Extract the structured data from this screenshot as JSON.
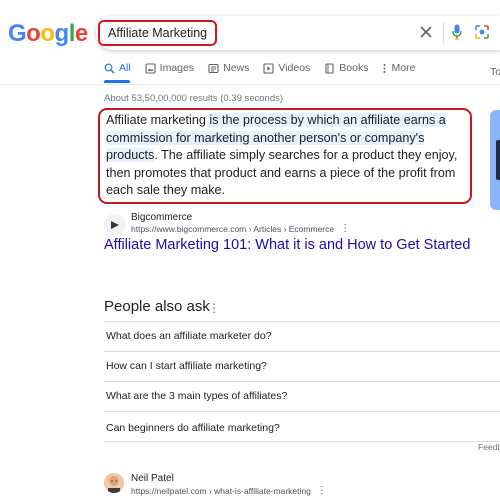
{
  "logo": {
    "letters": [
      "G",
      "o",
      "o",
      "g",
      "l",
      "e"
    ]
  },
  "search": {
    "query": "Affiliate Marketing"
  },
  "tabs": [
    {
      "label": "All",
      "icon": "search-icon",
      "active": true
    },
    {
      "label": "Images",
      "icon": "image-icon"
    },
    {
      "label": "News",
      "icon": "news-icon"
    },
    {
      "label": "Videos",
      "icon": "play-icon"
    },
    {
      "label": "Books",
      "icon": "book-icon"
    },
    {
      "label": "More",
      "icon": "more-dots-icon"
    }
  ],
  "tools_label": "To",
  "result_stats": "About 53,50,00,000 results (0.39 seconds)",
  "featured_snippet": {
    "part1": "Affiliate marketing ",
    "highlight1": "is the process by which an affiliate earns a commission for marketing another person's or company's products",
    "part2": ". The affiliate simply searches for a product they enjoy, then promotes that product and earns a piece of the profit from each sale they make."
  },
  "source": {
    "name": "Bigcommerce",
    "url": "https://www.bigcommerce.com › Articles › Ecommerce",
    "title": "Affiliate Marketing 101: What it is and How to Get Started"
  },
  "people_also_ask": {
    "title": "People also ask",
    "questions": [
      "What does an affiliate marketer do?",
      "How can I start affiliate marketing?",
      "What are the 3 main types of affiliates?",
      "Can beginners do affiliate marketing?"
    ]
  },
  "feedback_label": "Feedb",
  "next_result": {
    "name": "Neil Patel",
    "url": "https://neilpatel.com › what-is-affiliate-marketing"
  },
  "colors": {
    "google_blue": "#4285F4",
    "google_red": "#EA4335",
    "google_yellow": "#FBBC05",
    "google_green": "#34A853",
    "link": "#1a0dab",
    "highlight_box": "#c8161d"
  }
}
